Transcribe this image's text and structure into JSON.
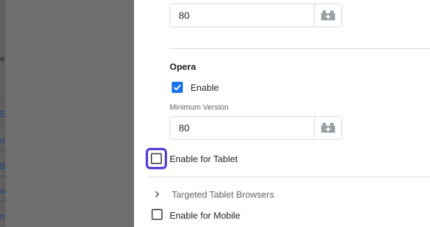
{
  "background_page": {
    "fragments": [
      "e",
      "E",
      "m",
      "B",
      "a",
      "n"
    ]
  },
  "panel": {
    "top_version_field": {
      "value": "80",
      "addon_icon": "puzzle-block-icon"
    },
    "opera": {
      "heading": "Opera",
      "enable_label": "Enable",
      "enable_checked": true,
      "min_version_label": "Minimum Version",
      "min_version_value": "80",
      "addon_icon": "puzzle-block-icon"
    },
    "tablet": {
      "enable_label": "Enable for Tablet",
      "enable_checked": false,
      "browsers_label": "Targeted Tablet Browsers"
    },
    "mobile": {
      "enable_label": "Enable for Mobile",
      "enable_checked": false
    }
  },
  "colors": {
    "accent": "#1a73e8",
    "focus_ring": "#4a3ad8",
    "overlay": "#6f6f6f",
    "border": "#dadce0",
    "secondary_text": "#5f6368"
  }
}
